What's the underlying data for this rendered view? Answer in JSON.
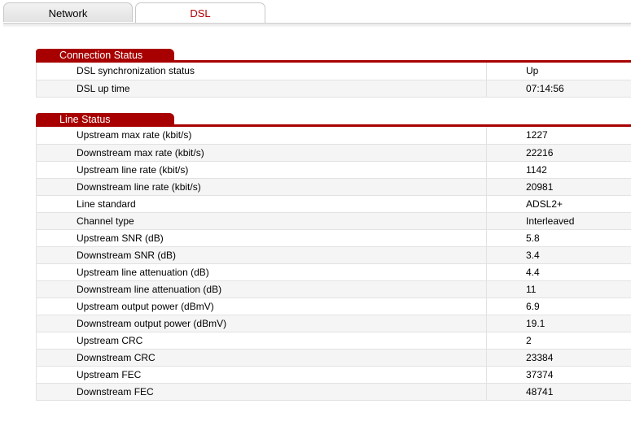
{
  "tabs": [
    {
      "label": "Network",
      "active": false
    },
    {
      "label": "DSL",
      "active": true
    }
  ],
  "colors": {
    "accent": "#a80000",
    "active_tab_text": "#b30000"
  },
  "connection_status": {
    "title": "Connection Status",
    "rows": [
      {
        "label": "DSL synchronization status",
        "value": "Up"
      },
      {
        "label": "DSL up time",
        "value": "07:14:56"
      }
    ]
  },
  "line_status": {
    "title": "Line Status",
    "rows": [
      {
        "label": "Upstream max rate (kbit/s)",
        "value": "1227"
      },
      {
        "label": "Downstream max rate (kbit/s)",
        "value": "22216"
      },
      {
        "label": "Upstream line rate (kbit/s)",
        "value": "1142"
      },
      {
        "label": "Downstream line rate (kbit/s)",
        "value": "20981"
      },
      {
        "label": "Line standard",
        "value": "ADSL2+"
      },
      {
        "label": "Channel type",
        "value": "Interleaved"
      },
      {
        "label": "Upstream SNR (dB)",
        "value": "5.8"
      },
      {
        "label": "Downstream SNR (dB)",
        "value": "3.4"
      },
      {
        "label": "Upstream line attenuation (dB)",
        "value": "4.4"
      },
      {
        "label": "Downstream line attenuation (dB)",
        "value": "11"
      },
      {
        "label": "Upstream output power (dBmV)",
        "value": "6.9"
      },
      {
        "label": "Downstream output power (dBmV)",
        "value": "19.1"
      },
      {
        "label": "Upstream CRC",
        "value": "2"
      },
      {
        "label": "Downstream CRC",
        "value": "23384"
      },
      {
        "label": "Upstream FEC",
        "value": "37374"
      },
      {
        "label": "Downstream FEC",
        "value": "48741"
      }
    ]
  }
}
